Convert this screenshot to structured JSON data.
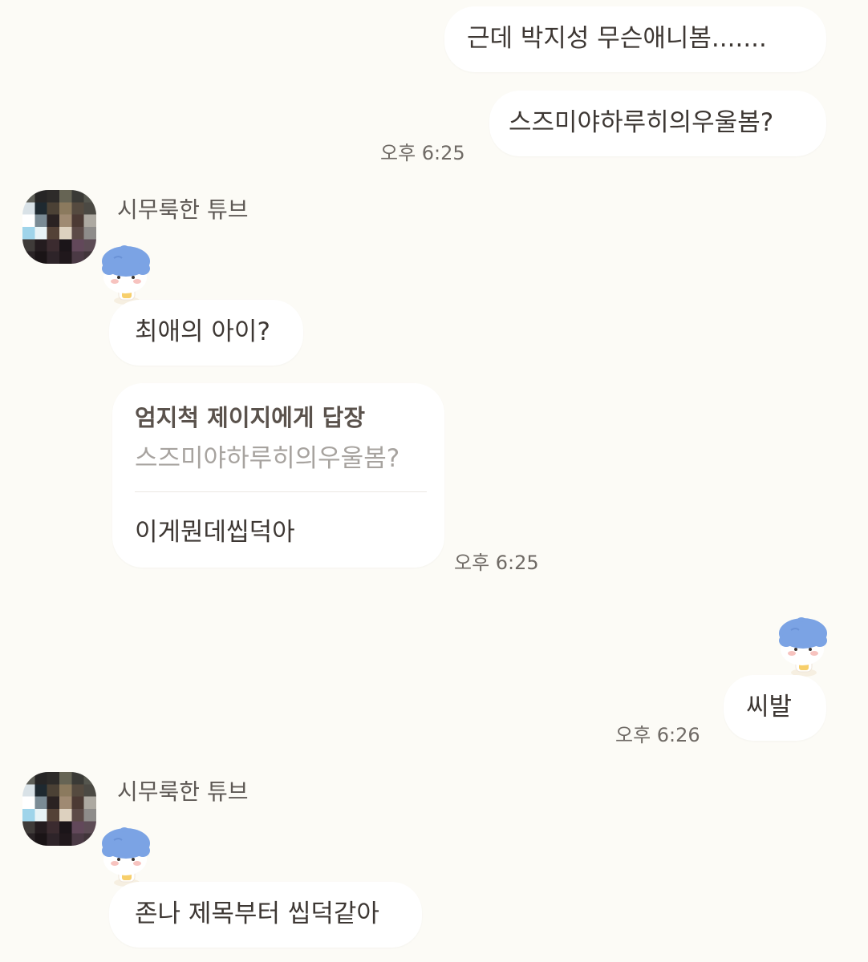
{
  "messages": {
    "m1": {
      "text": "근데 박지성 무슨애니봄......."
    },
    "m2": {
      "text": "스즈미야하루히의우울봄?",
      "time": "오후 6:25"
    },
    "m3": {
      "sender": "시무룩한 튜브",
      "text": "최애의 아이?"
    },
    "m4": {
      "reply_to": "엄지척 제이지에게 답장",
      "quoted": "스즈미야하루히의우울봄?",
      "text": "이게뭔데씹덕아",
      "time": "오후 6:25"
    },
    "m5": {
      "text": "씨발",
      "time": "오후 6:26"
    },
    "m6": {
      "sender": "시무룩한 튜브",
      "text": "존나 제목부터 씹덕같아"
    }
  },
  "icons": {
    "avatar": "pixelated-profile-avatar",
    "emoticon": "blue-haired-character-emoticon"
  },
  "colors": {
    "background": "#fcfbf6",
    "bubble": "#ffffff",
    "text": "#3d3733",
    "time": "#6f6a65",
    "quote": "#a7a39f"
  }
}
